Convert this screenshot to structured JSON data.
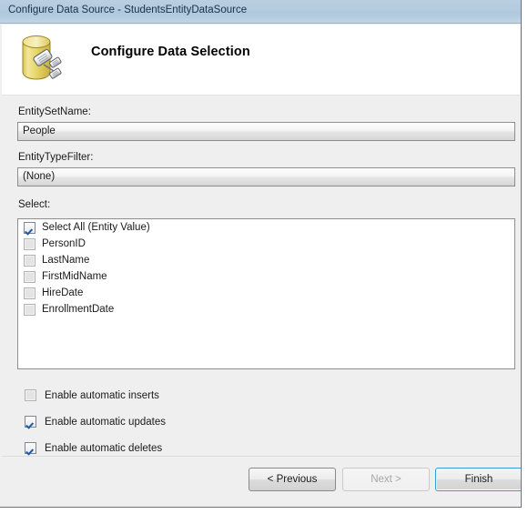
{
  "window": {
    "title": "Configure Data Source - StudentsEntityDataSource"
  },
  "header": {
    "icon": "entity-data-source-icon",
    "title": "Configure Data Selection"
  },
  "fields": {
    "entity_set_name": {
      "label": "EntitySetName:",
      "value": "People"
    },
    "entity_type_filter": {
      "label": "EntityTypeFilter:",
      "value": "(None)"
    },
    "select": {
      "label": "Select:",
      "items": [
        {
          "label": "Select All (Entity Value)",
          "checked": true,
          "disabled": false
        },
        {
          "label": "PersonID",
          "checked": false,
          "disabled": true
        },
        {
          "label": "LastName",
          "checked": false,
          "disabled": true
        },
        {
          "label": "FirstMidName",
          "checked": false,
          "disabled": true
        },
        {
          "label": "HireDate",
          "checked": false,
          "disabled": true
        },
        {
          "label": "EnrollmentDate",
          "checked": false,
          "disabled": true
        }
      ]
    }
  },
  "options": [
    {
      "label": "Enable automatic inserts",
      "checked": false,
      "disabled": true
    },
    {
      "label": "Enable automatic updates",
      "checked": true,
      "disabled": false
    },
    {
      "label": "Enable automatic deletes",
      "checked": true,
      "disabled": false
    }
  ],
  "buttons": {
    "previous": "< Previous",
    "next": "Next >",
    "finish": "Finish"
  },
  "colors": {
    "titlebar": "#b3cbdf",
    "body": "#efefef",
    "default_button_border": "#2d9fd4",
    "check_mark": "#1c5aa8",
    "icon_cylinder": "#e8d46a"
  }
}
